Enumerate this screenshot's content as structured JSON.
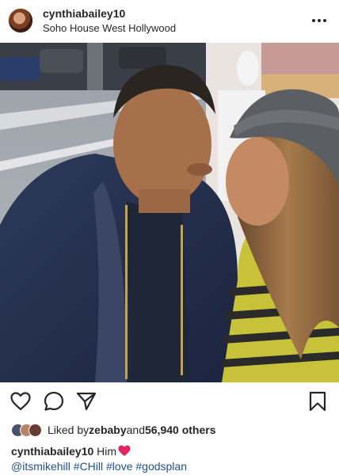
{
  "post": {
    "username": "cynthiabailey10",
    "location": "Soho House West Hollywood"
  },
  "likes": {
    "prefix": "Liked by ",
    "liked_by_user": "zebaby",
    "and_text": " and ",
    "others_count": "56,940 others"
  },
  "caption": {
    "author": "cynthiabailey10",
    "text": " Him"
  },
  "tags": {
    "mention": "@itsmikehill",
    "hashtags": [
      "#CHill",
      "#love",
      "#godsplan"
    ]
  },
  "colors": {
    "text": "#262626",
    "link": "#1f4e91",
    "heart": "#e0245e"
  },
  "icons": {
    "more": "more-options-icon",
    "like": "heart-outline-icon",
    "comment": "comment-bubble-icon",
    "share": "paper-plane-icon",
    "save": "bookmark-icon"
  }
}
